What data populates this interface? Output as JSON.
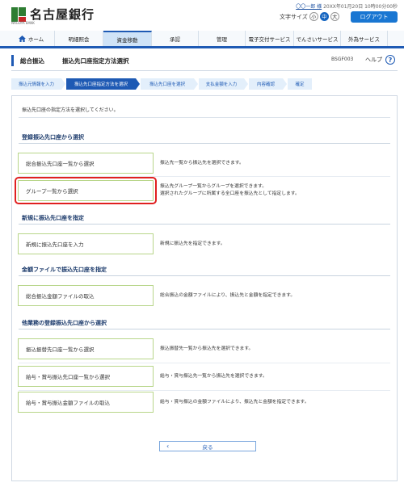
{
  "header": {
    "bank_name": "名古屋銀行",
    "bank_sub": "NAGOYA BANK",
    "user_line_name": "〇〇一郎 様",
    "user_line_time": "20XX年01月20日 10時00分00秒",
    "text_size_label": "文字サイズ",
    "text_size_small": "小",
    "text_size_medium": "中",
    "text_size_large": "大",
    "logout_label": "ログアウト"
  },
  "nav": {
    "items": [
      {
        "label": "ホーム"
      },
      {
        "label": "明細照会"
      },
      {
        "label": "資金移動"
      },
      {
        "label": "承認"
      },
      {
        "label": "管理"
      },
      {
        "label": "電子交付サービス"
      },
      {
        "label": "でんさいサービス"
      },
      {
        "label": "外為サービス"
      }
    ],
    "active_index": 2
  },
  "title": {
    "category": "総合振込",
    "page": "振込先口座指定方法選択",
    "screen_id": "BSGF003",
    "help_label": "ヘルプ",
    "help_icon": "question-icon"
  },
  "steps": [
    {
      "label": "振込元情報を入力",
      "state": "done"
    },
    {
      "label": "振込先口座指定方法を選択",
      "state": "current"
    },
    {
      "label": "振込先口座を選択",
      "state": "todo"
    },
    {
      "label": "支払金額を入力",
      "state": "todo"
    },
    {
      "label": "内容確認",
      "state": "todo"
    },
    {
      "label": "確定",
      "state": "todo"
    }
  ],
  "main": {
    "intro": "振込先口座の指定方法を選択してください。",
    "sections": [
      {
        "title": "登録振込先口座から選択"
      },
      {
        "title": "新規に振込先口座を指定"
      },
      {
        "title": "金額ファイルで振込先口座を指定"
      },
      {
        "title": "他業務の登録振込先口座から選択"
      }
    ],
    "options": [
      {
        "button": "総合振込先口座一覧から選択",
        "desc1": "振込先一覧から振込先を選択できます。",
        "desc2": ""
      },
      {
        "button": "グループ一覧から選択",
        "desc1": "振込先グループ一覧からグループを選択できます。",
        "desc2": "選択されたグループに所属する全口座を振込先として指定します。"
      },
      {
        "button": "新規に振込先口座を入力",
        "desc1": "新規に振込先を指定できます。",
        "desc2": ""
      },
      {
        "button": "総合振込金額ファイルの取込",
        "desc1": "総合振込の金額ファイルにより、振込先と金額を指定できます。",
        "desc2": ""
      },
      {
        "button": "振込振替先口座一覧から選択",
        "desc1": "振込振替先一覧から振込先を選択できます。",
        "desc2": ""
      },
      {
        "button": "給与・賞与振込先口座一覧から選択",
        "desc1": "給与・賞与振込先一覧から振込先を選択できます。",
        "desc2": ""
      },
      {
        "button": "給与・賞与振込金額ファイルの取込",
        "desc1": "給与・賞与振込の金額ファイルにより、振込先と金額を指定できます。",
        "desc2": ""
      }
    ],
    "highlighted_option_index": 1,
    "back_label": "戻る"
  },
  "colors": {
    "accent": "#1e5ab4",
    "button_border": "#b8d68a",
    "highlight": "#e02020",
    "logout": "#1976d2"
  }
}
